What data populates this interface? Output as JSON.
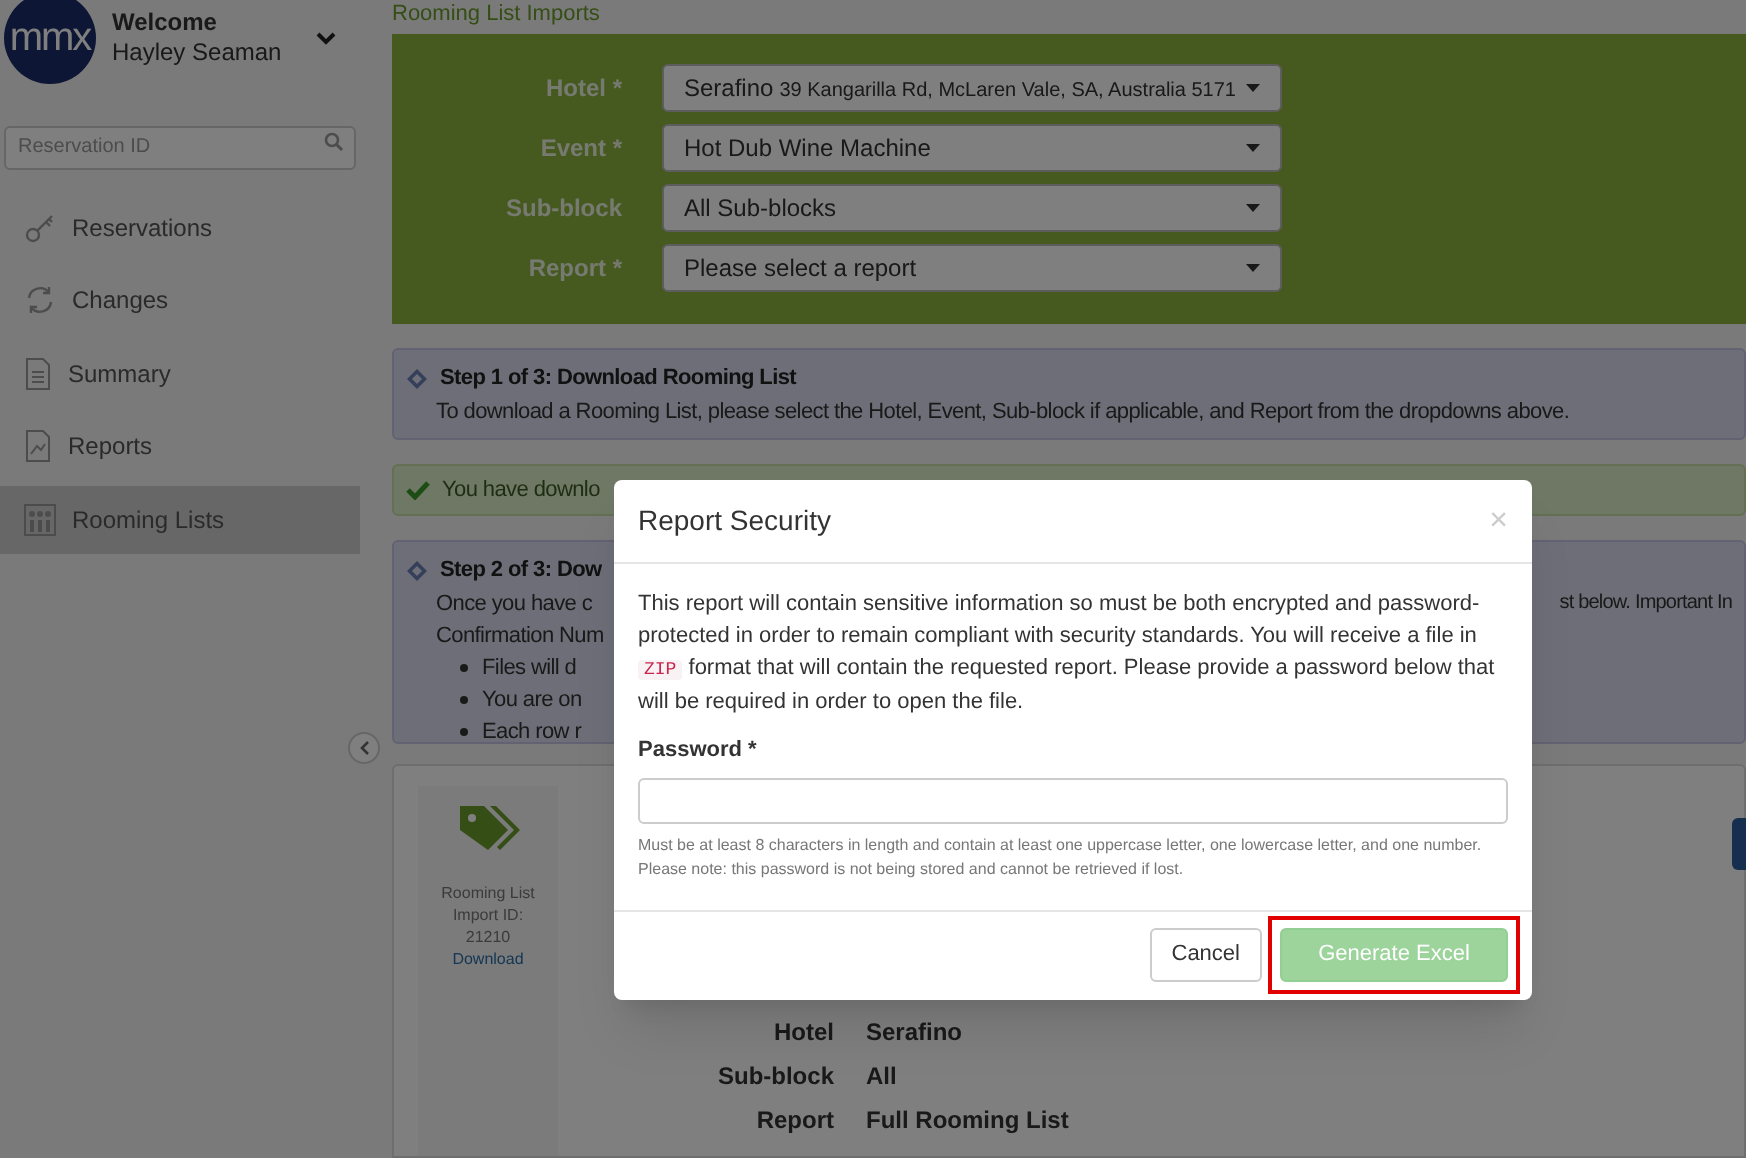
{
  "sidebar": {
    "logo": "mmx",
    "greeting": "Welcome",
    "user_name": "Hayley Seaman",
    "search": {
      "placeholder": "Reservation ID"
    },
    "items": [
      {
        "label": "Reservations",
        "selected": false
      },
      {
        "label": "Changes",
        "selected": false
      },
      {
        "label": "Summary",
        "selected": false
      },
      {
        "label": "Reports",
        "selected": false
      },
      {
        "label": "Rooming Lists",
        "selected": true
      }
    ]
  },
  "page_title": "Rooming List Imports",
  "filters": [
    {
      "label": "Hotel *",
      "value": "Serafino",
      "detail": "39 Kangarilla Rd, McLaren Vale, SA, Australia 5171"
    },
    {
      "label": "Event *",
      "value": "Hot Dub Wine Machine"
    },
    {
      "label": "Sub-block",
      "value": "All Sub-blocks"
    },
    {
      "label": "Report *",
      "value": "Please select a report"
    }
  ],
  "steps": [
    {
      "kind": "info",
      "title": "Step 1 of 3: Download Rooming List",
      "lines": [
        "To download a Rooming List, please select the Hotel, Event, Sub-block if applicable, and Report from the dropdowns above."
      ]
    },
    {
      "kind": "success",
      "title": "You have downlo"
    },
    {
      "kind": "info",
      "title": "Step 2 of 3: Dow",
      "lines": [
        "Once you have c",
        "Confirmation Num"
      ],
      "right_text": "st below. Important In",
      "bullets": [
        "Files will d",
        "You are on",
        "Each row r"
      ]
    }
  ],
  "import_card": {
    "label_lines": [
      "Rooming List",
      "Import ID:",
      "21210"
    ],
    "link": "Download",
    "details": [
      {
        "label": "Hotel",
        "value": "Serafino"
      },
      {
        "label": "Sub-block",
        "value": "All"
      },
      {
        "label": "Report",
        "value": "Full Rooming List"
      }
    ]
  },
  "modal": {
    "title": "Report Security",
    "close": "×",
    "text_before": "This report will contain sensitive information so must be both encrypted and password-protected in order to remain compliant with security standards. You will receive a file in",
    "code": "ZIP",
    "text_after": "format that will contain the requested report. Please provide a password below that will be required in order to open the file.",
    "field_label": "Password *",
    "help": "Must be at least 8 characters in length and contain at least one uppercase letter, one lowercase letter, and one number. Please note: this password is not being stored and cannot be retrieved if lost.",
    "buttons": [
      {
        "label": "Cancel",
        "kind": "default",
        "disabled": false,
        "highlighted": false
      },
      {
        "label": "Generate Excel",
        "kind": "success",
        "disabled": true,
        "highlighted": true
      }
    ]
  }
}
